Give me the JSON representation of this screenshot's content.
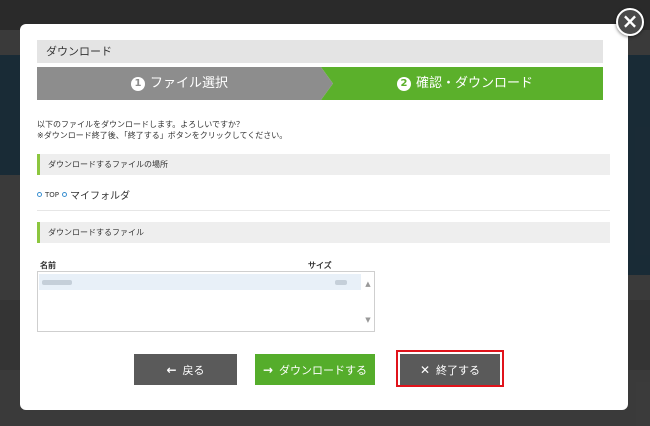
{
  "modal": {
    "title": "ダウンロード",
    "close_label": "×"
  },
  "steps": [
    {
      "num": "1",
      "label": "ファイル選択"
    },
    {
      "num": "2",
      "label": "確認・ダウンロード"
    }
  ],
  "message": {
    "line1": "以下のファイルをダウンロードします。よろしいですか？",
    "line2": "※ダウンロード終了後、「終了する」ボタンをクリックしてください。"
  },
  "location_section": {
    "heading": "ダウンロードするファイルの場所",
    "breadcrumb": [
      "TOP",
      "マイフォルダ"
    ]
  },
  "files_section": {
    "heading": "ダウンロードするファイル",
    "columns": {
      "name": "名前",
      "size": "サイズ"
    }
  },
  "buttons": {
    "back": "戻る",
    "download": "ダウンロードする",
    "finish": "終了する"
  },
  "icons": {
    "back": "arrow-left-icon",
    "download": "arrow-right-icon",
    "finish": "x-icon"
  },
  "colors": {
    "accent_green": "#5bb02b",
    "step_inactive": "#8d8d8d",
    "highlight_red": "#e0131b"
  }
}
